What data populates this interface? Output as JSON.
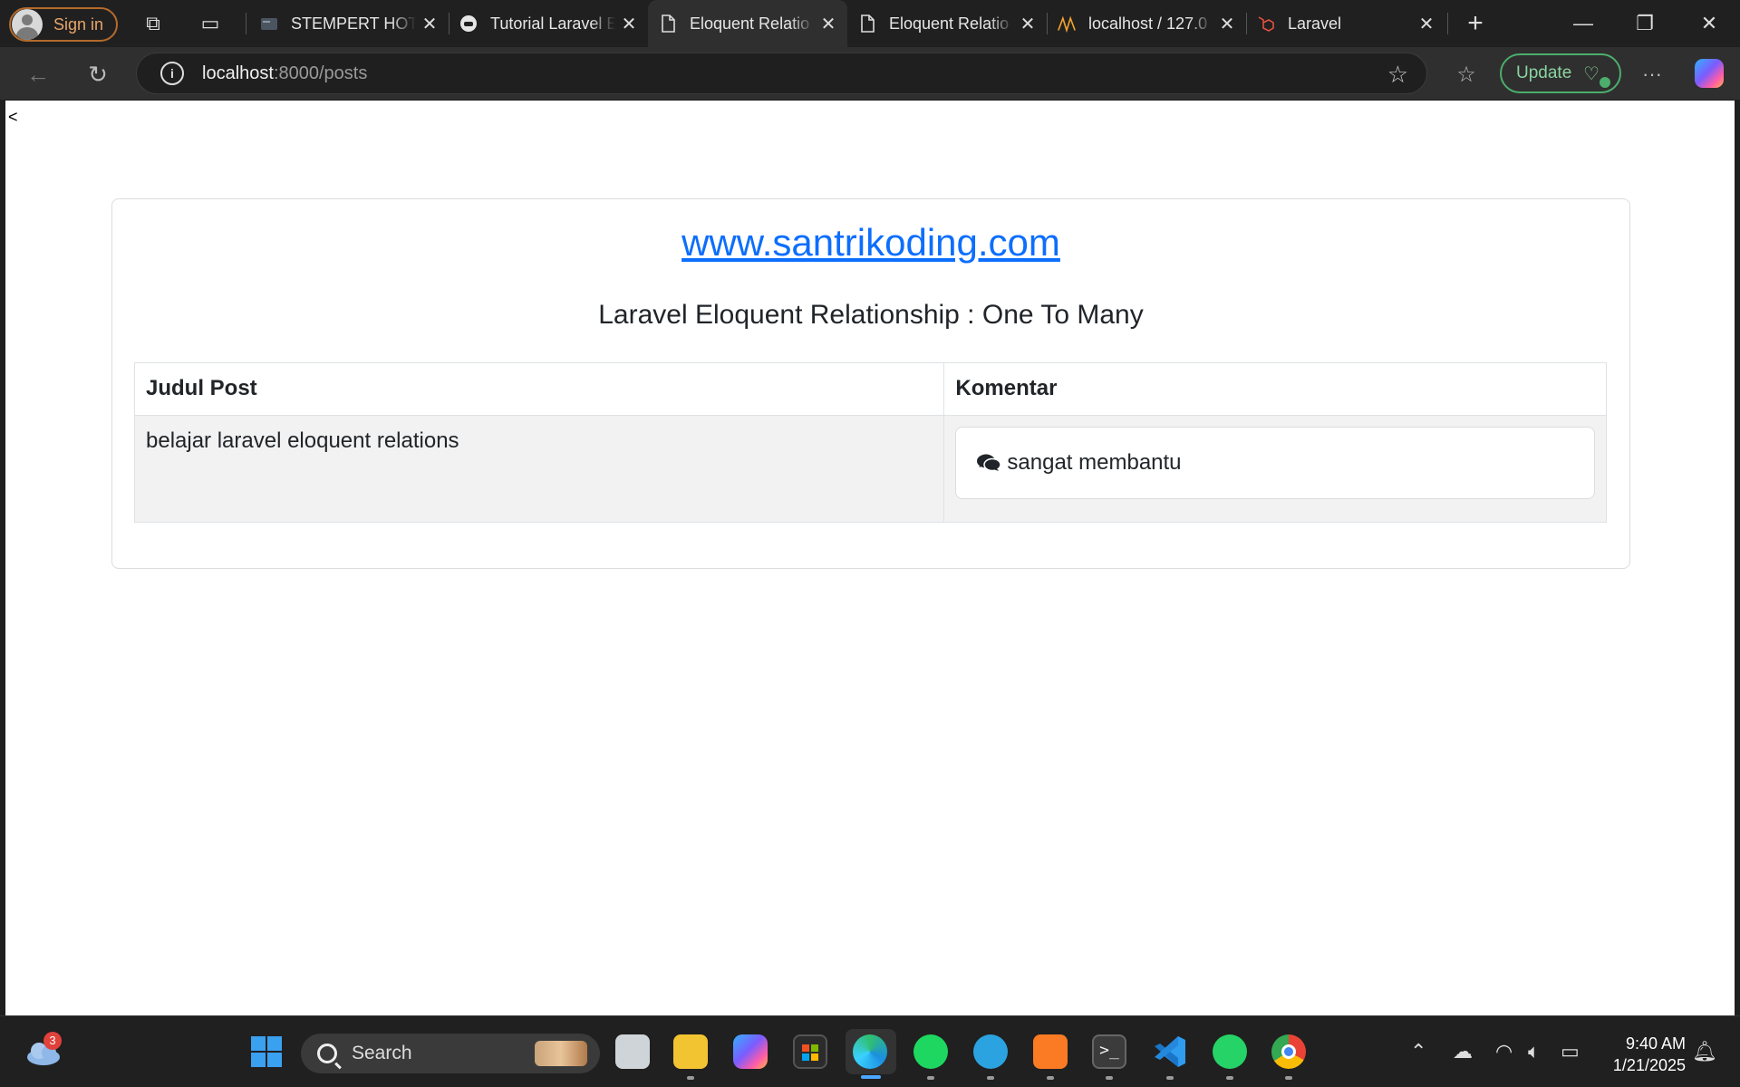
{
  "browser": {
    "signin_label": "Sign in",
    "tabs": [
      {
        "title": "STEMPERT HOTS",
        "favicon": "folder-favicon"
      },
      {
        "title": "Tutorial Laravel E",
        "favicon": "gitlab-favicon"
      },
      {
        "title": "Eloquent Relatio",
        "favicon": "page-favicon",
        "active": true
      },
      {
        "title": "Eloquent Relatio",
        "favicon": "page-favicon"
      },
      {
        "title": "localhost / 127.0",
        "favicon": "phpmyadmin-favicon"
      },
      {
        "title": "Laravel",
        "favicon": "laravel-favicon"
      }
    ],
    "url_host": "localhost",
    "url_path": ":8000/posts",
    "update_label": "Update"
  },
  "page": {
    "stray_text": "<",
    "site_link": "www.santrikoding.com",
    "subtitle": "Laravel Eloquent Relationship : One To Many",
    "table": {
      "headers": [
        "Judul Post",
        "Komentar"
      ],
      "rows": [
        {
          "title": "belajar laravel eloquent relations",
          "comments": [
            "sangat membantu"
          ]
        }
      ]
    }
  },
  "taskbar": {
    "weather_badge": "3",
    "search_placeholder": "Search",
    "time": "9:40 AM",
    "date": "1/21/2025"
  }
}
